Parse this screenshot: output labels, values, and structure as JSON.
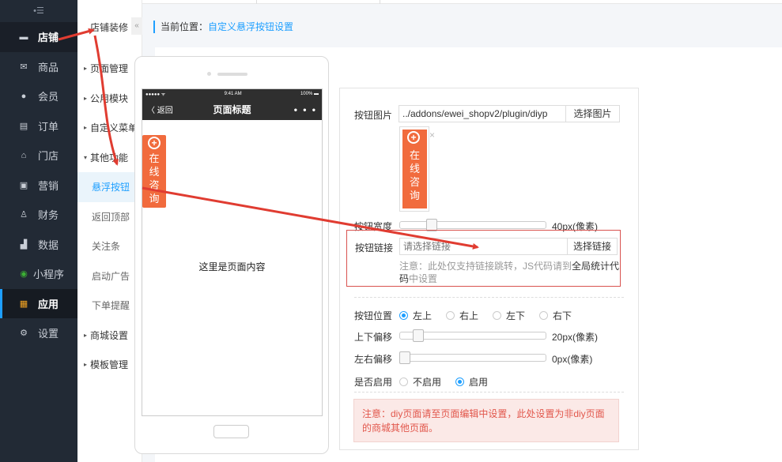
{
  "sidebar": {
    "collapse_glyph": "•☰",
    "items": [
      {
        "label": "店铺",
        "icon": "store-icon",
        "glyph": "▬"
      },
      {
        "label": "商品",
        "icon": "goods-icon",
        "glyph": "✉"
      },
      {
        "label": "会员",
        "icon": "member-icon",
        "glyph": "●"
      },
      {
        "label": "订单",
        "icon": "order-icon",
        "glyph": "▤"
      },
      {
        "label": "门店",
        "icon": "shop-icon",
        "glyph": "⌂"
      },
      {
        "label": "营销",
        "icon": "gift-icon",
        "glyph": "▣"
      },
      {
        "label": "财务",
        "icon": "finance-icon",
        "glyph": "♙"
      },
      {
        "label": "数据",
        "icon": "chart-icon",
        "glyph": "▟"
      },
      {
        "label": "小程序",
        "icon": "miniapp-icon",
        "glyph": "◉"
      },
      {
        "label": "应用",
        "icon": "apps-icon",
        "glyph": "▦"
      },
      {
        "label": "设置",
        "icon": "gear-icon",
        "glyph": "⚙"
      }
    ]
  },
  "subnav": {
    "header": "店铺装修",
    "toggle": "«",
    "items": [
      {
        "label": "页面管理",
        "caret": "▸"
      },
      {
        "label": "公用模块",
        "caret": "▸"
      },
      {
        "label": "自定义菜单",
        "caret": "▸"
      },
      {
        "label": "其他功能",
        "caret": "▾"
      },
      {
        "label": "悬浮按钮"
      },
      {
        "label": "返回顶部"
      },
      {
        "label": "关注条"
      },
      {
        "label": "启动广告"
      },
      {
        "label": "下单提醒"
      },
      {
        "label": "商城设置",
        "caret": "▸"
      },
      {
        "label": "模板管理",
        "caret": "▸"
      }
    ]
  },
  "breadcrumb": {
    "prefix": "当前位置：",
    "current": "自定义悬浮按钮设置"
  },
  "phone": {
    "status_left": "●●●●● ᯤ",
    "status_time": "9:41 AM",
    "status_right": "100% ▬",
    "back": "〈 返回",
    "title": "页面标题",
    "more": "• • •",
    "float_plus": "+",
    "float_chars": [
      "在",
      "线",
      "咨",
      "询"
    ],
    "content": "这里是页面内容"
  },
  "settings": {
    "image_label": "按钮图片",
    "image_path": "../addons/ewei_shopv2/plugin/diyp",
    "select_image": "选择图片",
    "thumb_close": "×",
    "width_label": "按钮宽度",
    "width_value": "40px(像素)",
    "width_fraction": 0.2,
    "link_label": "按钮链接",
    "link_placeholder": "请选择链接",
    "select_link": "选择链接",
    "note_prefix": "注意：此处仅支持链接跳转，JS代码请到",
    "note_bold": "全局统计代码",
    "note_suffix": "中设置",
    "position_label": "按钮位置",
    "positions": [
      "左上",
      "右上",
      "左下",
      "右下"
    ],
    "v_offset_label": "上下偏移",
    "v_offset_value": "20px(像素)",
    "v_offset_fraction": 0.1,
    "h_offset_label": "左右偏移",
    "h_offset_value": "0px(像素)",
    "h_offset_fraction": 0,
    "enable_label": "是否启用",
    "enable_options": [
      "不启用",
      "启用"
    ],
    "alert": "注意：diy页面请至页面编辑中设置，此处设置为非diy页面的商城其他页面。"
  },
  "colors": {
    "accent": "#1e9fff",
    "sidebar_bg": "#222a35",
    "float_button": "#f16b3d",
    "annotation": "#e03c31"
  }
}
